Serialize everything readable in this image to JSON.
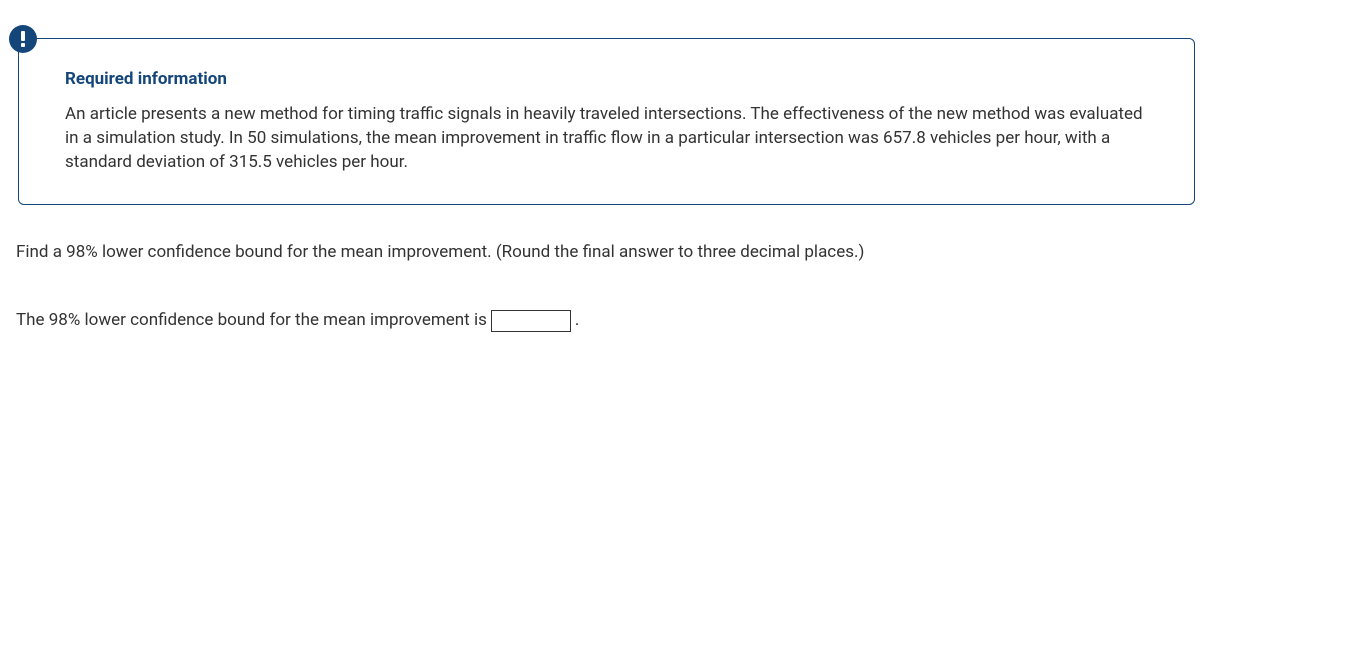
{
  "infoBox": {
    "title": "Required information",
    "body": "An article presents a new method for timing traffic signals in heavily traveled intersections. The effectiveness of the new method was evaluated in a simulation study. In 50 simulations, the mean improvement in traffic flow in a particular intersection was 657.8 vehicles per hour, with a standard deviation of 315.5 vehicles per hour."
  },
  "question": "Find a 98% lower confidence bound for the mean improvement. (Round the final answer to three decimal places.)",
  "answer": {
    "prefix": "The 98% lower confidence bound for the mean improvement is",
    "value": "",
    "suffix": "."
  }
}
